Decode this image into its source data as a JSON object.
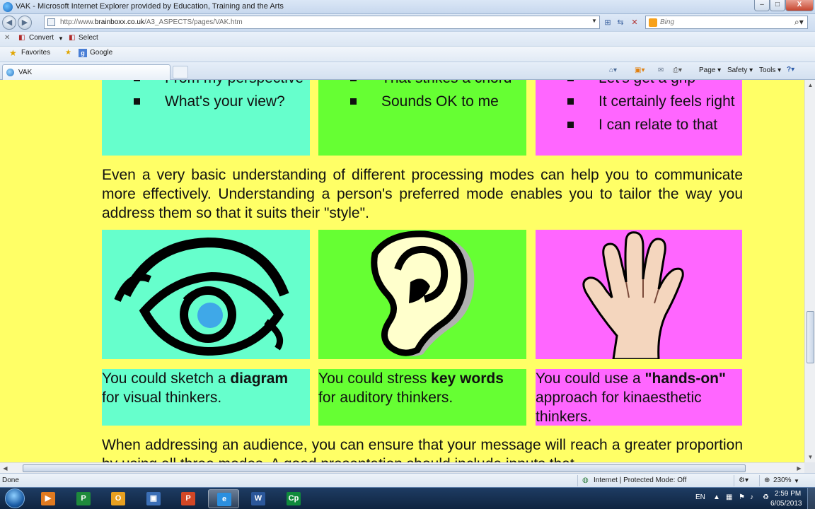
{
  "window": {
    "title": "VAK - Microsoft Internet Explorer provided by Education, Training and the Arts",
    "min_label": "–",
    "max_label": "□",
    "close_label": "X"
  },
  "address": {
    "url_prefix": "http://www.",
    "url_domain": "brainboxx.co.uk",
    "url_path": "/A3_ASPECTS/pages/VAK.htm",
    "search_placeholder": "Bing"
  },
  "toolbar": {
    "convert_label": "Convert",
    "select_label": "Select",
    "favorites_label": "Favorites",
    "google_label": "Google"
  },
  "tabs": [
    {
      "label": "VAK"
    }
  ],
  "command_bar": {
    "page_label": "Page",
    "safety_label": "Safety",
    "tools_label": "Tools"
  },
  "content": {
    "visual_bullets": [
      "From my perspective",
      "What's your view?"
    ],
    "auditory_bullets": [
      "That strikes a chord",
      "Sounds OK to me"
    ],
    "kinaesthetic_bullets": [
      "Let's get a grip",
      "It certainly feels right",
      "I can relate to that"
    ],
    "paragraph1": "Even a very basic understanding of different processing modes can help you to communicate more effectively.  Understanding a person's preferred mode enables you to tailor the way you address them so that it suits their \"style\".",
    "visual_caption_a": "You could sketch a ",
    "visual_caption_b": "diagram",
    "visual_caption_c": "for visual thinkers.",
    "auditory_caption_a": "You could stress ",
    "auditory_caption_b": "key words",
    "auditory_caption_c": "for auditory thinkers.",
    "kin_caption_a": "You could use a ",
    "kin_caption_b": "\"hands-on\"",
    "kin_caption_c": " approach for kinaesthetic thinkers.",
    "paragraph2": "When addressing an audience, you can ensure that your message will reach a greater proportion by using all three modes. A good presentation should include inputs that"
  },
  "status": {
    "left": "Done",
    "zone": "Internet | Protected Mode: Off",
    "zoom": "230%"
  },
  "taskbar": {
    "language": "EN",
    "time": "2:59 PM",
    "date": "6/05/2013",
    "apps": [
      {
        "name": "media-player",
        "glyph": "▶",
        "color": "#e07a20"
      },
      {
        "name": "publisher",
        "glyph": "P",
        "color": "#1e8a3c"
      },
      {
        "name": "outlook",
        "glyph": "O",
        "color": "#e8a020"
      },
      {
        "name": "remote-desktop",
        "glyph": "▣",
        "color": "#3b6fb6"
      },
      {
        "name": "powerpoint",
        "glyph": "P",
        "color": "#d24726"
      },
      {
        "name": "internet-explorer",
        "glyph": "e",
        "color": "#2b8fe0"
      },
      {
        "name": "word",
        "glyph": "W",
        "color": "#2b579a"
      },
      {
        "name": "captivate",
        "glyph": "Cp",
        "color": "#0f8a3c"
      }
    ]
  },
  "colors": {
    "page_bg": "#ffff66",
    "visual": "#66ffcc",
    "auditory": "#66ff33",
    "kinaesthetic": "#ff66ff"
  }
}
